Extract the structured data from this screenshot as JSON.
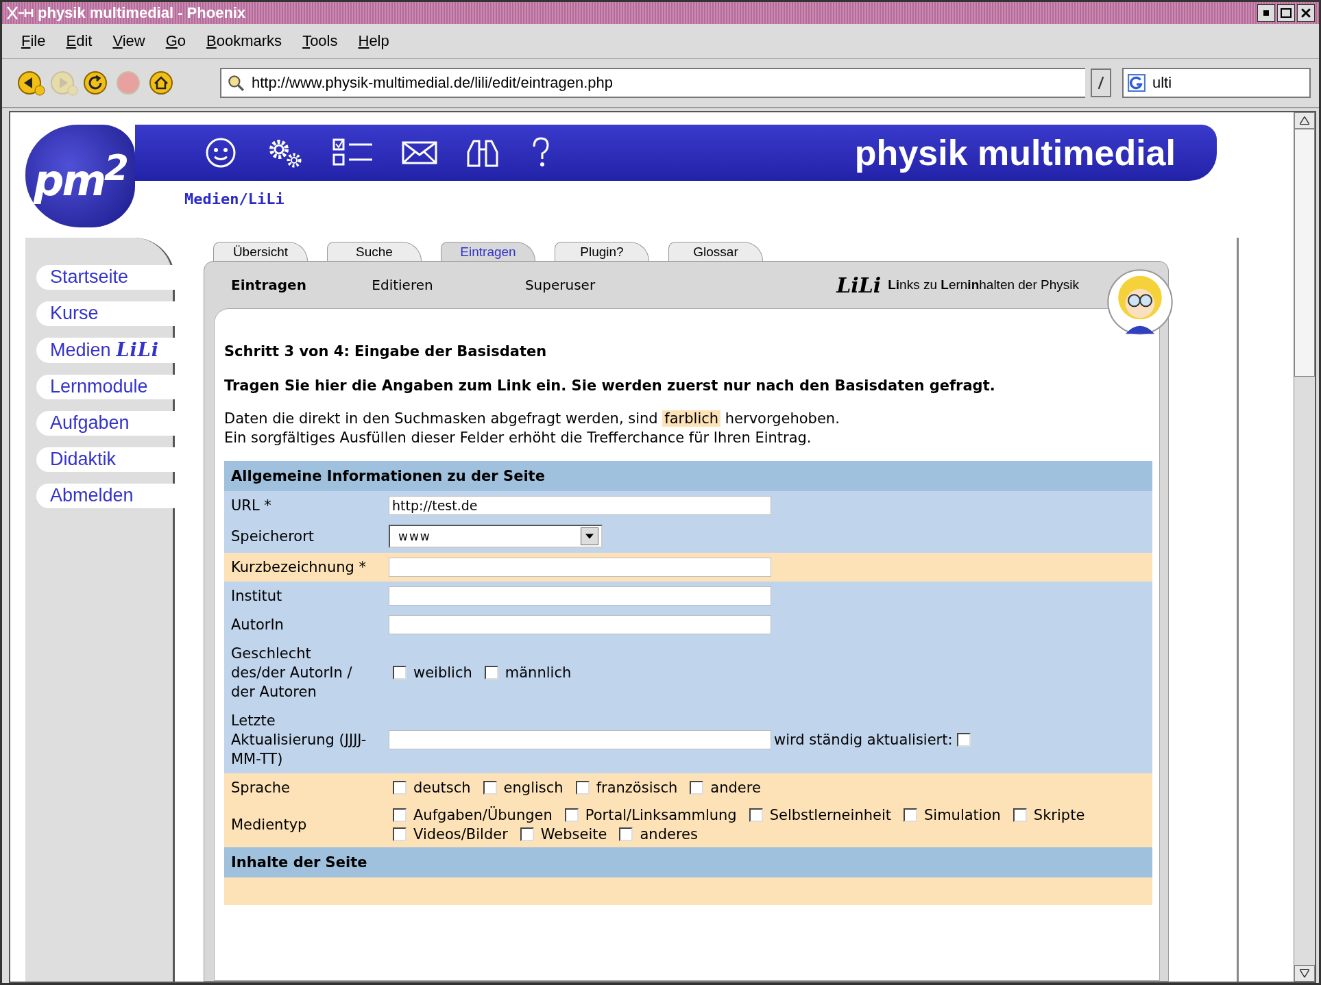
{
  "window": {
    "title": "physik multimedial - Phoenix"
  },
  "menu": [
    "File",
    "Edit",
    "View",
    "Go",
    "Bookmarks",
    "Tools",
    "Help"
  ],
  "toolbar": {
    "buttons": [
      {
        "kind": "back",
        "disabled": false
      },
      {
        "kind": "forward",
        "disabled": true
      },
      {
        "kind": "reload",
        "disabled": false
      },
      {
        "kind": "stop",
        "disabled": true
      },
      {
        "kind": "home",
        "disabled": false
      }
    ],
    "address": "http://www.physik-multimedial.de/lili/edit/eintragen.php",
    "search": "ulti"
  },
  "site": {
    "logo": "pm$^{2}$",
    "brand": "physik multimedial",
    "breadcrumb": "Medien/LiLi"
  },
  "sidebar": {
    "items": [
      {
        "label": "Startseite"
      },
      {
        "label": "Kurse"
      },
      {
        "label": "Medien",
        "suffix": "LiLi"
      },
      {
        "label": "Lernmodule"
      },
      {
        "label": "Aufgaben"
      },
      {
        "label": "Didaktik"
      },
      {
        "label": "Abmelden"
      }
    ]
  },
  "tabs": [
    {
      "label": "Übersicht",
      "selected": false
    },
    {
      "label": "Suche",
      "selected": false
    },
    {
      "label": "Eintragen",
      "selected": true
    },
    {
      "label": "Plugin?",
      "selected": false
    },
    {
      "label": "Glossar",
      "selected": false
    }
  ],
  "subtabs": [
    {
      "label": "Eintragen",
      "selected": true
    },
    {
      "label": "Editieren",
      "selected": false
    },
    {
      "label": "Superuser",
      "selected": false
    }
  ],
  "lili": {
    "logo": "LiLi",
    "tagline": "**Li**nks zu **L**ern**in**halten der Physik"
  },
  "content": {
    "heading": "Schritt 3 von 4: Eingabe der Basisdaten",
    "instruction": "Tragen Sie hier die Angaben zum Link ein. Sie werden zuerst nur nach den Basisdaten gefragt.",
    "note": {
      "before": "Daten die direkt in den Suchmasken abgefragt werden, sind",
      "highlight": "farblich",
      "after": "hervorgehoben."
    },
    "note_2": "Ein sorgfältiges Ausfüllen dieser Felder erhöht die Trefferchance für Ihren Eintrag."
  },
  "sections": [
    {
      "title": "Allgemeine Informationen zu der Seite",
      "rows": [
        {
          "kind": "text",
          "label": "URL *",
          "highlighted": false,
          "value": "http://test.de"
        },
        {
          "kind": "select",
          "label": "Speicherort",
          "highlighted": false,
          "value": "www"
        },
        {
          "kind": "text",
          "label": "Kurzbezeichnung *",
          "highlighted": true
        },
        {
          "kind": "text",
          "label": "Institut",
          "highlighted": false
        },
        {
          "kind": "text",
          "label": "AutorIn",
          "highlighted": false
        },
        {
          "kind": "checks",
          "label": "Geschlecht des/der AutorIn / der Autoren",
          "highlighted": false,
          "options": [
            {
              "label": "weiblich",
              "checked": false
            },
            {
              "label": "männlich",
              "checked": false
            }
          ]
        },
        {
          "kind": "text",
          "label": "Letzte Aktualisierung (JJJJ-MM-TT)",
          "highlighted": false,
          "extra": {
            "label": "wird ständig aktualisiert:",
            "checked": false
          }
        },
        {
          "kind": "checks",
          "label": "Sprache",
          "highlighted": true,
          "options": [
            {
              "label": "deutsch",
              "checked": false
            },
            {
              "label": "englisch",
              "checked": false
            },
            {
              "label": "französisch",
              "checked": false
            },
            {
              "label": "andere",
              "checked": false
            }
          ]
        },
        {
          "kind": "checks",
          "label": "Medientyp",
          "highlighted": true,
          "options": [
            {
              "label": "Aufgaben/Übungen",
              "checked": false
            },
            {
              "label": "Portal/Linksammlung",
              "checked": false
            },
            {
              "label": "Selbstlerneinheit",
              "checked": false
            },
            {
              "label": "Simulation",
              "checked": false
            },
            {
              "label": "Skripte",
              "checked": false
            },
            {
              "label": "Videos/Bilder",
              "checked": false
            },
            {
              "label": "Webseite",
              "checked": false
            },
            {
              "label": "anderes",
              "checked": false
            }
          ]
        }
      ]
    },
    {
      "title": "Inhalte der Seite"
    }
  ]
}
